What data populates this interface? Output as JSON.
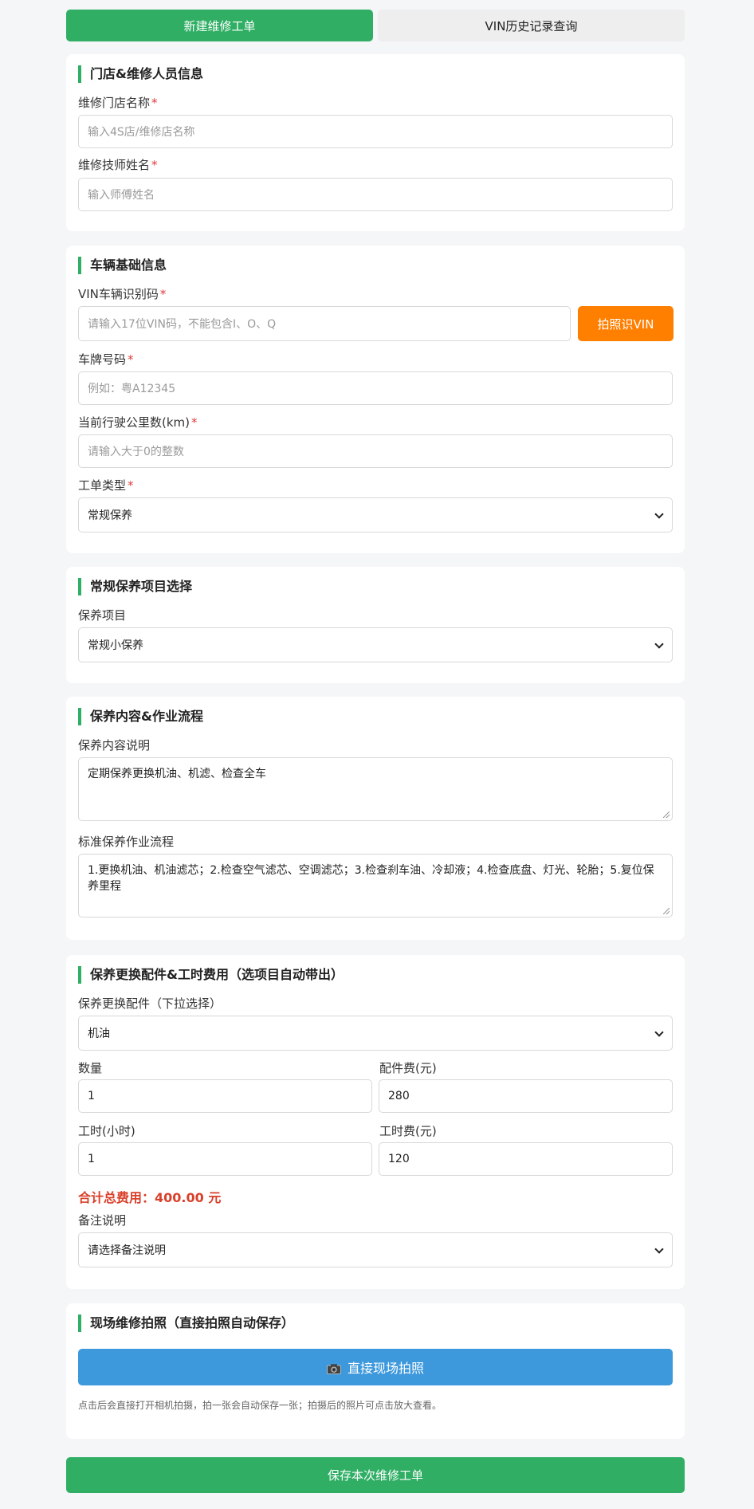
{
  "tabs": {
    "new_order": "新建维修工单",
    "vin_history": "VIN历史记录查询"
  },
  "shop": {
    "title": "门店&维修人员信息",
    "store_label": "维修门店名称",
    "store_placeholder": "输入4S店/维修店名称",
    "tech_label": "维修技师姓名",
    "tech_placeholder": "输入师傅姓名"
  },
  "vehicle": {
    "title": "车辆基础信息",
    "vin_label": "VIN车辆识别码",
    "vin_placeholder": "请输入17位VIN码，不能包含I、O、Q",
    "vin_button": "拍照识VIN",
    "plate_label": "车牌号码",
    "plate_placeholder": "例如：粤A12345",
    "mileage_label": "当前行驶公里数(km)",
    "mileage_placeholder": "请输入大于0的整数",
    "type_label": "工单类型",
    "type_value": "常规保养",
    "required_mark": "*"
  },
  "maint_select": {
    "title": "常规保养项目选择",
    "item_label": "保养项目",
    "item_value": "常规小保养"
  },
  "content": {
    "title": "保养内容&作业流程",
    "desc_label": "保养内容说明",
    "desc_value": "定期保养更换机油、机滤、检查全车",
    "flow_label": "标准保养作业流程",
    "flow_value": "1.更换机油、机油滤芯；2.检查空气滤芯、空调滤芯；3.检查刹车油、冷却液；4.检查底盘、灯光、轮胎；5.复位保养里程"
  },
  "parts": {
    "title": "保养更换配件&工时费用（选项目自动带出）",
    "part_label": "保养更换配件（下拉选择）",
    "part_value": "机油",
    "qty_label": "数量",
    "qty_value": "1",
    "part_fee_label": "配件费(元)",
    "part_fee_value": "280",
    "hours_label": "工时(小时)",
    "hours_value": "1",
    "labor_fee_label": "工时费(元)",
    "labor_fee_value": "120",
    "total_text": "合计总费用：400.00 元",
    "remark_label": "备注说明",
    "remark_value": "请选择备注说明"
  },
  "photo": {
    "title": "现场维修拍照（直接拍照自动保存）",
    "button": "直接现场拍照",
    "hint": "点击后会直接打开相机拍摄，拍一张会自动保存一张；拍摄后的照片可点击放大查看。"
  },
  "save_button": "保存本次维修工单",
  "colors": {
    "primary": "#2fae64",
    "orange": "#ff7f00",
    "blue": "#3d99dc",
    "total_red": "#d9402b"
  }
}
